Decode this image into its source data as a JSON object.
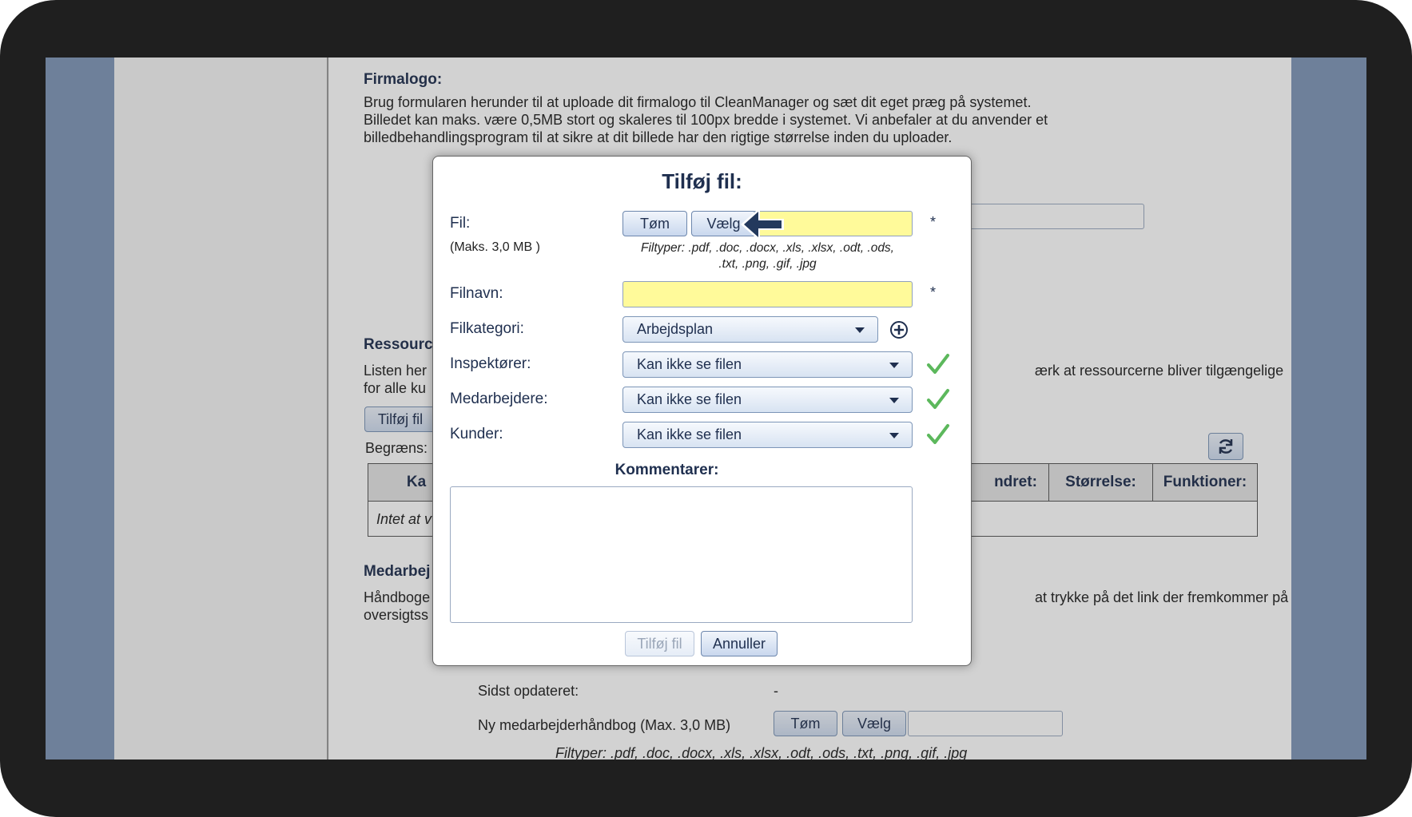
{
  "background": {
    "firmalogo_title": "Firmalogo:",
    "firmalogo_text": [
      "Brug formularen herunder til at uploade dit firmalogo til CleanManager og sæt dit eget præg på systemet.",
      "Billedet kan maks. være 0,5MB stort og skaleres til 100px bredde i systemet. Vi anbefaler at du anvender et",
      "billedbehandlingsprogram til at sikre at dit billede har den rigtige størrelse inden du uploader."
    ],
    "ressource_title_partial": "Ressourc",
    "ressource_text_left_1": "Listen her",
    "ressource_text_left_2": "for alle ku",
    "ressource_text_right": "ærk at ressourcerne bliver tilgængelige",
    "add_file_button": "Tilføj fil",
    "limit_label_partial": "Begræns:",
    "table_headers": {
      "col1_partial": "Ka",
      "changed_partial": "ndret:",
      "size": "Størrelse:",
      "functions": "Funktioner:"
    },
    "table_empty_partial": "Intet at v",
    "medarbejder_title_partial": "Medarbej",
    "medarbejder_text_left_1": "Håndboge",
    "medarbejder_text_left_2": "oversigtss",
    "medarbejder_text_right": "at trykke på det link der fremkommer på",
    "last_updated_label": "Sidst opdateret:",
    "last_updated_value": "-",
    "new_handbook_label": "Ny medarbejderhåndbog (Max. 3,0 MB)",
    "clear_button": "Tøm",
    "choose_button": "Vælg",
    "file_types": "Filtyper: .pdf, .doc, .docx, .xls, .xlsx, .odt, .ods, .txt, .png, .gif, .jpg"
  },
  "dialog": {
    "title": "Tilføj fil:",
    "file_label": "Fil:",
    "max_size": "(Maks. 3,0 MB )",
    "clear_button": "Tøm",
    "choose_button": "Vælg",
    "file_types_line1": "Filtyper: .pdf, .doc, .docx, .xls, .xlsx, .odt, .ods,",
    "file_types_line2": ".txt, .png, .gif, .jpg",
    "required_marker": "*",
    "filename_label": "Filnavn:",
    "filename_value": "",
    "category_label": "Filkategori:",
    "category_value": "Arbejdsplan",
    "inspectors_label": "Inspektører:",
    "inspectors_value": "Kan ikke se filen",
    "employees_label": "Medarbejdere:",
    "employees_value": "Kan ikke se filen",
    "customers_label": "Kunder:",
    "customers_value": "Kan ikke se filen",
    "comments_label": "Kommentarer:",
    "comments_value": "",
    "submit_button": "Tilføj fil",
    "cancel_button": "Annuller"
  },
  "colors": {
    "required_field": "#fffa9a",
    "check": "#5cb85c",
    "arrow": "#23395d",
    "frame": "#1f1f1f"
  },
  "icons": [
    "plus-circle-icon",
    "checkmark-icon",
    "arrow-left-icon",
    "refresh-icon",
    "chevron-down-icon"
  ]
}
